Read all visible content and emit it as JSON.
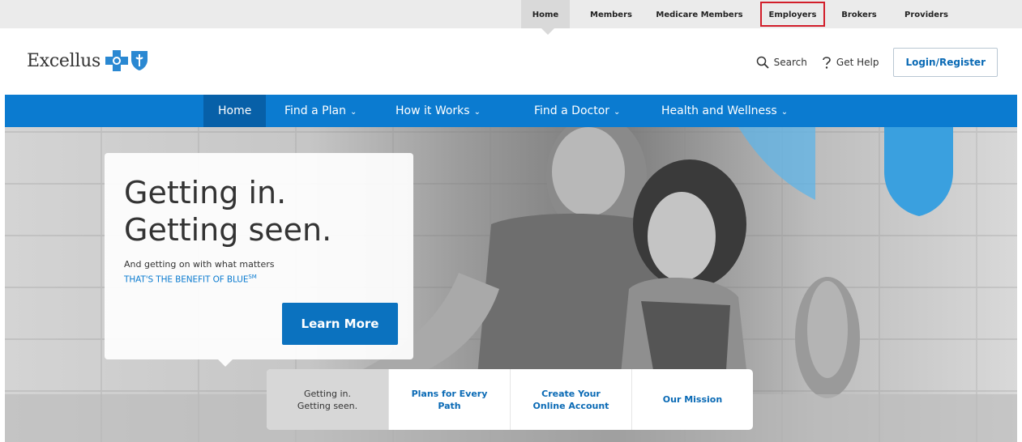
{
  "utility_nav": {
    "items": [
      {
        "label": "Home",
        "active": true
      },
      {
        "label": "Members"
      },
      {
        "label": "Medicare Members"
      },
      {
        "label": "Employers",
        "highlighted": true
      },
      {
        "label": "Brokers"
      },
      {
        "label": "Providers"
      }
    ]
  },
  "header": {
    "logo_text": "Excellus",
    "search_label": "Search",
    "help_label": "Get Help",
    "login_label": "Login/Register"
  },
  "main_nav": {
    "items": [
      {
        "label": "Home",
        "active": true
      },
      {
        "label": "Find a Plan",
        "dropdown": true
      },
      {
        "label": "How it Works",
        "dropdown": true
      },
      {
        "label": "Find a Doctor",
        "dropdown": true
      },
      {
        "label": "Health and Wellness",
        "dropdown": true
      }
    ],
    "chevron": "⌄"
  },
  "hero": {
    "title_line1": "Getting in.",
    "title_line2": "Getting seen.",
    "subtitle": "And getting on with what matters",
    "tagline": "THAT'S THE BENEFIT OF BLUE",
    "tagline_mark": "SM",
    "cta_label": "Learn More"
  },
  "hero_tabs": [
    {
      "line1": "Getting in.",
      "line2": "Getting seen.",
      "active": true
    },
    {
      "line1": "Plans for Every",
      "line2": "Path"
    },
    {
      "line1": "Create Your",
      "line2": "Online Account"
    },
    {
      "line1": "Our Mission",
      "line2": ""
    }
  ],
  "colors": {
    "brand_blue": "#0b7bd0",
    "nav_active": "#0760a8",
    "highlight_red": "#d21e2a"
  },
  "icons": [
    "search-icon",
    "help-icon",
    "blue-cross-icon",
    "blue-shield-icon",
    "chevron-down-icon"
  ]
}
